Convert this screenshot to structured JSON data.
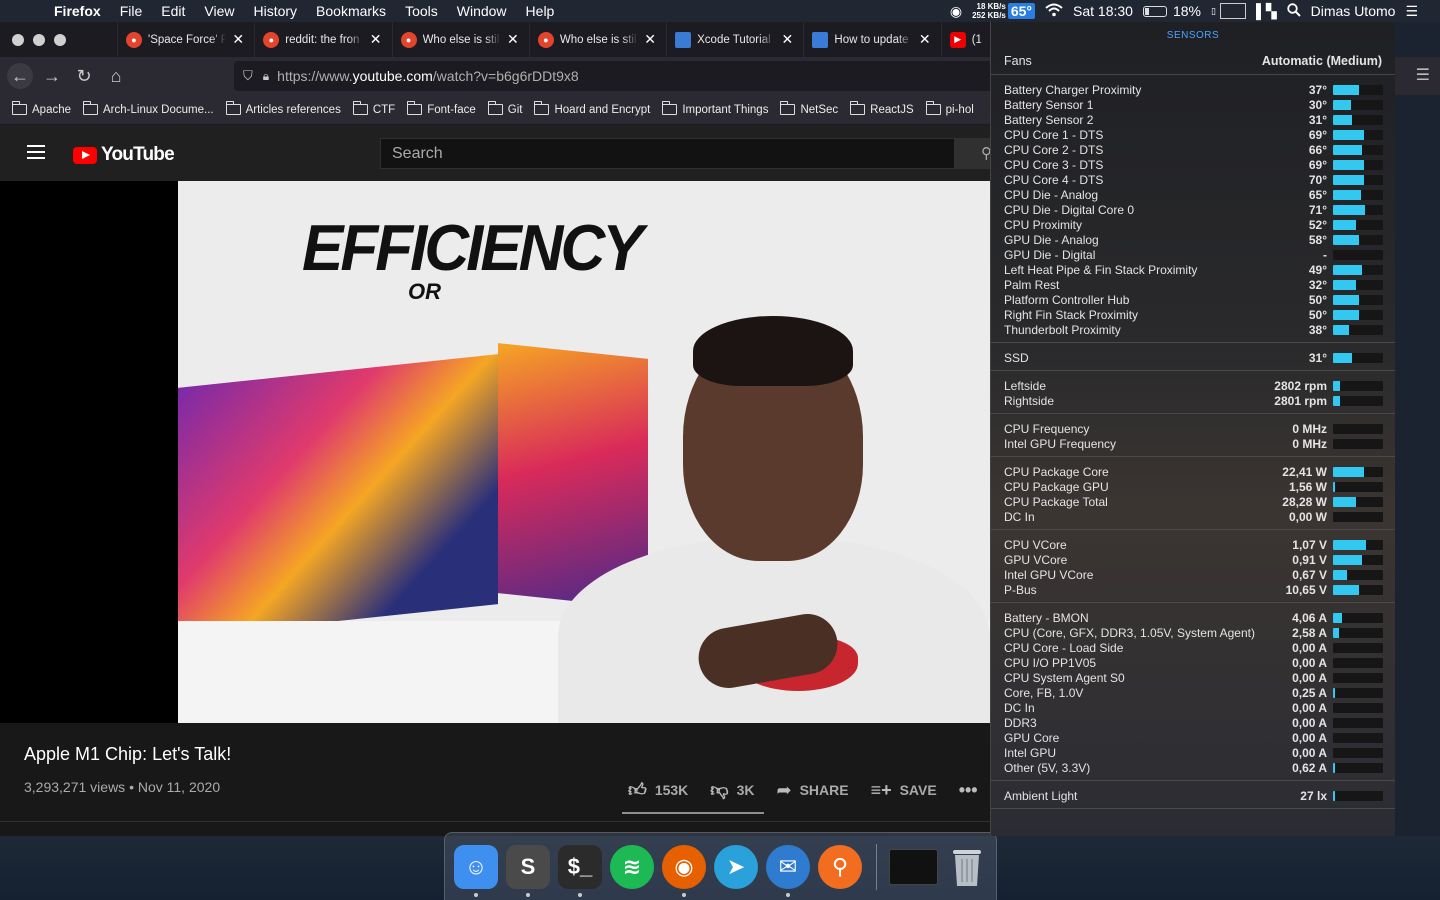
{
  "menubar": {
    "app_name": "Firefox",
    "menus": [
      "File",
      "Edit",
      "View",
      "History",
      "Bookmarks",
      "Tools",
      "Window",
      "Help"
    ],
    "net_up": "18 KB/s",
    "net_down": "252 KB/s",
    "temp": "65°",
    "clock": "Sat 18:30",
    "battery": "18%",
    "user": "Dimas Utomo"
  },
  "tabs": [
    {
      "label": "'Space Force' P",
      "icon": "reddit-icon"
    },
    {
      "label": "reddit: the fron",
      "icon": "reddit-icon"
    },
    {
      "label": "Who else is stil",
      "icon": "reddit-icon"
    },
    {
      "label": "Who else is stil",
      "icon": "reddit-icon"
    },
    {
      "label": "Xcode Tutorial",
      "icon": "site-icon"
    },
    {
      "label": "How to update",
      "icon": "site-icon"
    },
    {
      "label": "(1",
      "icon": "youtube-icon"
    }
  ],
  "url": {
    "prefix": "https://www.",
    "domain": "youtube.com",
    "path": "/watch?v=b6g6rDDt9x8"
  },
  "bookmarks": [
    "Apache",
    "Arch-Linux Docume...",
    "Articles references",
    "CTF",
    "Font-face",
    "Git",
    "Hoard and Encrypt",
    "Important Things",
    "NetSec",
    "ReactJS",
    "pi-hol"
  ],
  "youtube": {
    "logo_text": "YouTube",
    "search_placeholder": "Search",
    "overlay_title": "EFFICIENCY",
    "overlay_sub": "OR",
    "video_title": "Apple M1 Chip: Let's Talk!",
    "video_meta": "3,293,271 views • Nov 11, 2020",
    "likes": "153K",
    "dislikes": "3K",
    "share": "SHARE",
    "save": "SAVE"
  },
  "sensors": {
    "header": "SENSORS",
    "fans_label": "Fans",
    "fans_value": "Automatic (Medium)",
    "sections": [
      {
        "rows": [
          {
            "label": "Battery Charger Proximity",
            "value": "37°",
            "level": 0.52
          },
          {
            "label": "Battery Sensor 1",
            "value": "30°",
            "level": 0.36
          },
          {
            "label": "Battery Sensor 2",
            "value": "31°",
            "level": 0.38
          },
          {
            "label": "CPU Core 1 - DTS",
            "value": "69°",
            "level": 0.62
          },
          {
            "label": "CPU Core 2 - DTS",
            "value": "66°",
            "level": 0.58
          },
          {
            "label": "CPU Core 3 - DTS",
            "value": "69°",
            "level": 0.62
          },
          {
            "label": "CPU Core 4 - DTS",
            "value": "70°",
            "level": 0.62
          },
          {
            "label": "CPU Die - Analog",
            "value": "65°",
            "level": 0.56
          },
          {
            "label": "CPU Die - Digital Core 0",
            "value": "71°",
            "level": 0.64
          },
          {
            "label": "CPU Proximity",
            "value": "52°",
            "level": 0.46
          },
          {
            "label": "GPU Die - Analog",
            "value": "58°",
            "level": 0.52
          },
          {
            "label": "GPU Die - Digital",
            "value": "-",
            "level": 0
          },
          {
            "label": "Left Heat Pipe & Fin Stack Proximity",
            "value": "49°",
            "level": 0.58
          },
          {
            "label": "Palm Rest",
            "value": "32°",
            "level": 0.46
          },
          {
            "label": "Platform Controller Hub",
            "value": "50°",
            "level": 0.52
          },
          {
            "label": "Right Fin Stack Proximity",
            "value": "50°",
            "level": 0.52
          },
          {
            "label": "Thunderbolt Proximity",
            "value": "38°",
            "level": 0.32
          }
        ]
      },
      {
        "rows": [
          {
            "label": "SSD",
            "value": "31°",
            "level": 0.38
          }
        ]
      },
      {
        "rows": [
          {
            "label": "Leftside",
            "value": "2802 rpm",
            "level": 0.14
          },
          {
            "label": "Rightside",
            "value": "2801 rpm",
            "level": 0.14
          }
        ]
      },
      {
        "rows": [
          {
            "label": "CPU Frequency",
            "value": "0 MHz",
            "level": 0
          },
          {
            "label": "Intel GPU Frequency",
            "value": "0 MHz",
            "level": 0
          }
        ]
      },
      {
        "rows": [
          {
            "label": "CPU Package Core",
            "value": "22,41 W",
            "level": 0.62
          },
          {
            "label": "CPU Package GPU",
            "value": "1,56 W",
            "level": 0.04
          },
          {
            "label": "CPU Package Total",
            "value": "28,28 W",
            "level": 0.46
          },
          {
            "label": "DC In",
            "value": "0,00 W",
            "level": 0
          }
        ]
      },
      {
        "rows": [
          {
            "label": "CPU VCore",
            "value": "1,07 V",
            "level": 0.66
          },
          {
            "label": "GPU VCore",
            "value": "0,91 V",
            "level": 0.58
          },
          {
            "label": "Intel GPU VCore",
            "value": "0,67 V",
            "level": 0.28
          },
          {
            "label": "P-Bus",
            "value": "10,65 V",
            "level": 0.52
          }
        ]
      },
      {
        "rows": [
          {
            "label": "Battery - BMON",
            "value": "4,06 A",
            "level": 0.18
          },
          {
            "label": "CPU (Core, GFX, DDR3, 1.05V, System Agent)",
            "value": "2,58 A",
            "level": 0.12
          },
          {
            "label": "CPU Core - Load Side",
            "value": "0,00 A",
            "level": 0
          },
          {
            "label": "CPU I/O PP1V05",
            "value": "0,00 A",
            "level": 0
          },
          {
            "label": "CPU System Agent S0",
            "value": "0,00 A",
            "level": 0
          },
          {
            "label": "Core, FB, 1.0V",
            "value": "0,25 A",
            "level": 0.04
          },
          {
            "label": "DC In",
            "value": "0,00 A",
            "level": 0
          },
          {
            "label": "DDR3",
            "value": "0,00 A",
            "level": 0
          },
          {
            "label": "GPU Core",
            "value": "0,00 A",
            "level": 0
          },
          {
            "label": "Intel GPU",
            "value": "0,00 A",
            "level": 0
          },
          {
            "label": "Other (5V, 3.3V)",
            "value": "0,62 A",
            "level": 0.04
          }
        ]
      },
      {
        "rows": [
          {
            "label": "Ambient Light",
            "value": "27 lx",
            "level": 0.03
          }
        ]
      }
    ]
  },
  "dock": [
    {
      "name": "finder",
      "color": "#3e8ff0",
      "glyph": "☺",
      "running": true
    },
    {
      "name": "sublime-text",
      "color": "#4a4a4a",
      "glyph": "S",
      "running": true
    },
    {
      "name": "terminal",
      "color": "#2b2b2b",
      "glyph": "$_",
      "running": true
    },
    {
      "name": "spotify",
      "color": "#1db954",
      "glyph": "≋",
      "running": false
    },
    {
      "name": "firefox",
      "color": "#e66000",
      "glyph": "◉",
      "running": true
    },
    {
      "name": "telegram",
      "color": "#2aa1da",
      "glyph": "➤",
      "running": false
    },
    {
      "name": "mail-app",
      "color": "#2f7bd0",
      "glyph": "✉",
      "running": true
    },
    {
      "name": "vpn-app",
      "color": "#f36d21",
      "glyph": "⚲",
      "running": false
    }
  ]
}
